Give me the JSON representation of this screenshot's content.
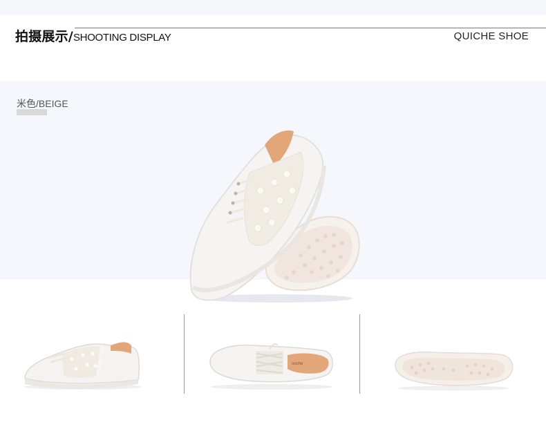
{
  "header": {
    "title_zh": "拍摄展示/",
    "title_en": "SHOOTING DISPLAY",
    "brand": "QUICHE SHOE"
  },
  "hero": {
    "color_label": "米色/BEIGE",
    "swatch_color": "#d9d9d9"
  },
  "thumbnails": {
    "insole_text": "ooche"
  },
  "colors": {
    "hero_background": "#f5f7fc",
    "shoe_white": "#f4f3f1",
    "insole_tan": "#e2a679"
  }
}
